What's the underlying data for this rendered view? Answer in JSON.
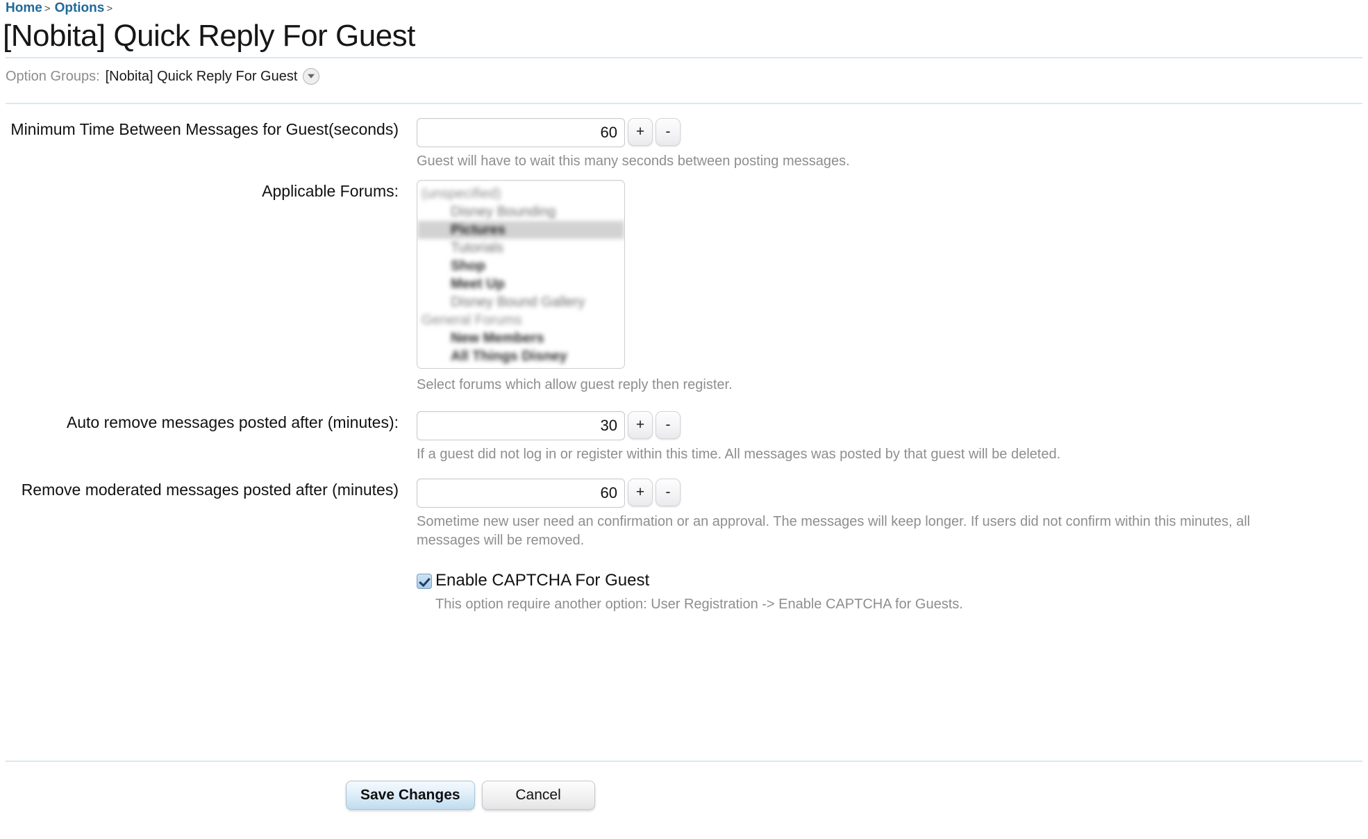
{
  "breadcrumb": {
    "items": [
      {
        "label": "Home",
        "sep": ">"
      },
      {
        "label": "Options",
        "sep": ">"
      }
    ]
  },
  "page": {
    "title": "[Nobita] Quick Reply For Guest"
  },
  "option_groups": {
    "label": "Option Groups:",
    "value": "[Nobita] Quick Reply For Guest",
    "dropdown_icon": "chevron-down-circle-icon"
  },
  "fields": {
    "min_time": {
      "label": "Minimum Time Between Messages for Guest(seconds)",
      "value": "60",
      "hint": "Guest will have to wait this many seconds between posting messages.",
      "plus": "+",
      "minus": "-"
    },
    "applicable_forums": {
      "label": "Applicable Forums:",
      "hint": "Select forums which allow guest reply then register.",
      "options": [
        {
          "text": "(unspecified)",
          "type": "cat",
          "selected": false
        },
        {
          "text": "Disney Bounding",
          "type": "child",
          "selected": false
        },
        {
          "text": "Pictures",
          "type": "child",
          "selected": true
        },
        {
          "text": "Tutorials",
          "type": "child",
          "selected": false
        },
        {
          "text": "Shop",
          "type": "child-bold",
          "selected": false
        },
        {
          "text": "Meet Up",
          "type": "child-bold",
          "selected": false
        },
        {
          "text": "Disney Bound Gallery",
          "type": "child",
          "selected": false
        },
        {
          "text": "General Forums",
          "type": "cat",
          "selected": false
        },
        {
          "text": "New Members",
          "type": "child-bold",
          "selected": false
        },
        {
          "text": "All Things Disney",
          "type": "child-bold",
          "selected": false
        }
      ]
    },
    "auto_remove": {
      "label": "Auto remove messages posted after (minutes):",
      "value": "30",
      "hint": "If a guest did not log in or register within this time. All messages was posted by that guest will be deleted.",
      "plus": "+",
      "minus": "-"
    },
    "remove_moderated": {
      "label": "Remove moderated messages posted after (minutes)",
      "value": "60",
      "hint": "Sometime new user need an confirmation or an approval. The messages will keep longer. If users did not confirm within this minutes, all messages will be removed.",
      "plus": "+",
      "minus": "-"
    },
    "captcha": {
      "label": "Enable CAPTCHA For Guest",
      "checked": true,
      "hint": "This option require another option: User Registration -> Enable CAPTCHA for Guests."
    }
  },
  "footer": {
    "save_label": "Save Changes",
    "cancel_label": "Cancel"
  },
  "colors": {
    "link": "#1f6a9a",
    "rule": "#d9e8f0",
    "hint": "#8e8e8e",
    "selected_row": "#d2d2d2",
    "primary_button": "#bfdcef"
  }
}
